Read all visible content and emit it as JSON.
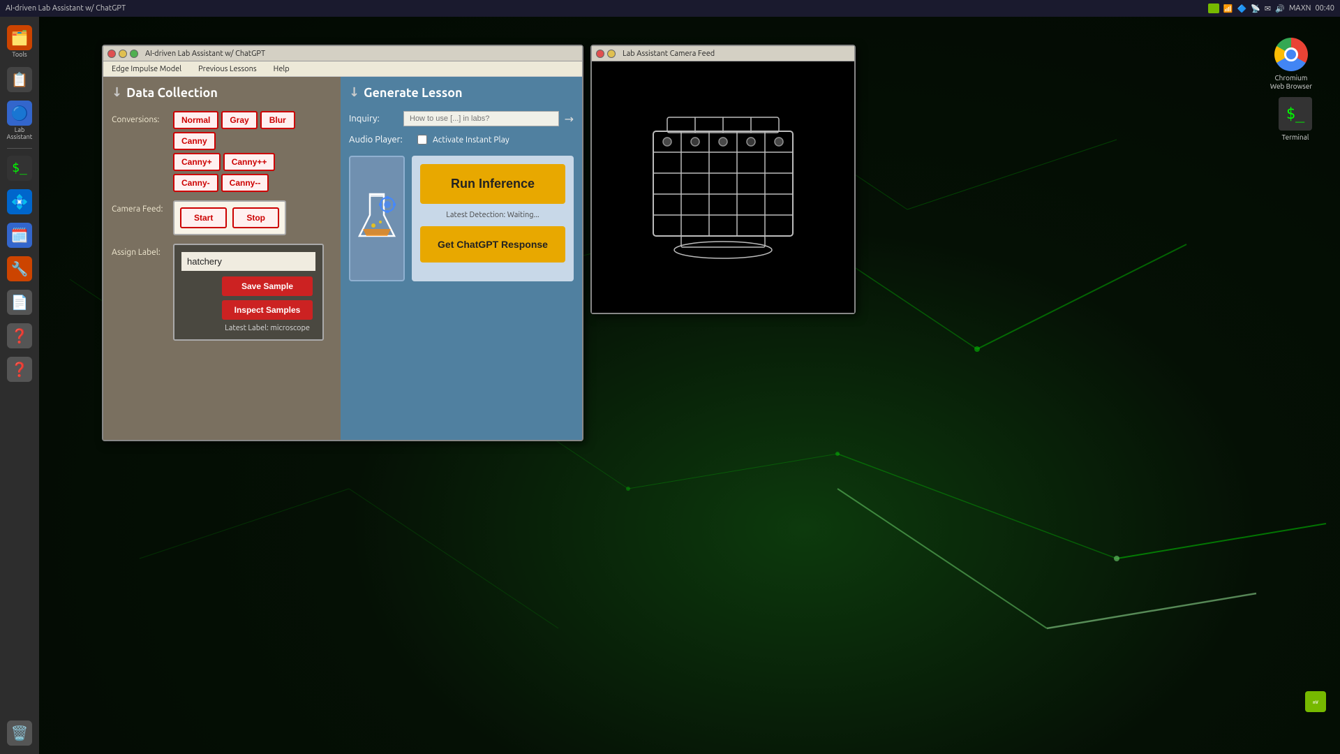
{
  "taskbar": {
    "title": "AI-driven Lab Assistant w/ ChatGPT",
    "icons": [
      "nvidia",
      "wifi",
      "bluetooth",
      "network",
      "mail",
      "speaker"
    ],
    "time": "00:40",
    "user": "MAXN"
  },
  "sidebar": {
    "items": [
      {
        "label": "Tools",
        "icon": "🗂️",
        "color": "#cc4400"
      },
      {
        "label": "",
        "icon": "📋",
        "color": "#555"
      },
      {
        "label": "Lab\nAssistant",
        "icon": "🔵",
        "color": "#3366cc"
      },
      {
        "label": "",
        "icon": "💻",
        "color": "#555"
      },
      {
        "label": "",
        "icon": "🗓️",
        "color": "#3366cc"
      },
      {
        "label": "",
        "icon": "🔧",
        "color": "#cc4400"
      },
      {
        "label": "",
        "icon": "📄",
        "color": "#555"
      },
      {
        "label": "",
        "icon": "❓",
        "color": "#555"
      },
      {
        "label": "",
        "icon": "❓",
        "color": "#555"
      }
    ],
    "bottom": {
      "icon": "🗑️",
      "label": ""
    }
  },
  "app_window": {
    "title": "AI-driven Lab Assistant w/ ChatGPT",
    "menu": [
      "Edge Impulse Model",
      "Previous Lessons",
      "Help"
    ],
    "left_panel": {
      "title": "Data Collection",
      "conversions_label": "Conversions:",
      "buttons": [
        "Normal",
        "Gray",
        "Blur",
        "Canny",
        "Canny+",
        "Canny++",
        "Canny-",
        "Canny--"
      ],
      "camera_feed_label": "Camera Feed:",
      "start_btn": "Start",
      "stop_btn": "Stop",
      "assign_label_label": "Assign Label:",
      "input_value": "hatchery",
      "save_btn": "Save Sample",
      "inspect_btn": "Inspect Samples",
      "latest_label": "Latest Label: microscope"
    },
    "right_panel": {
      "title": "Generate Lesson",
      "inquiry_label": "Inquiry:",
      "inquiry_placeholder": "How to use [...] in labs?",
      "audio_label": "Audio Player:",
      "activate_label": "Activate Instant Play",
      "run_inference_btn": "Run Inference",
      "detection_status": "Latest Detection: Waiting...",
      "chatgpt_btn": "Get ChatGPT Response"
    }
  },
  "camera_window": {
    "title": "Lab Assistant Camera Feed",
    "feed_description": "Camera feed showing sketch of lab equipment"
  },
  "desktop": {
    "chromium_label": "Chromium\nWeb Browser",
    "terminal_label": "Terminal",
    "nvidia_label": "NVIDIA"
  }
}
